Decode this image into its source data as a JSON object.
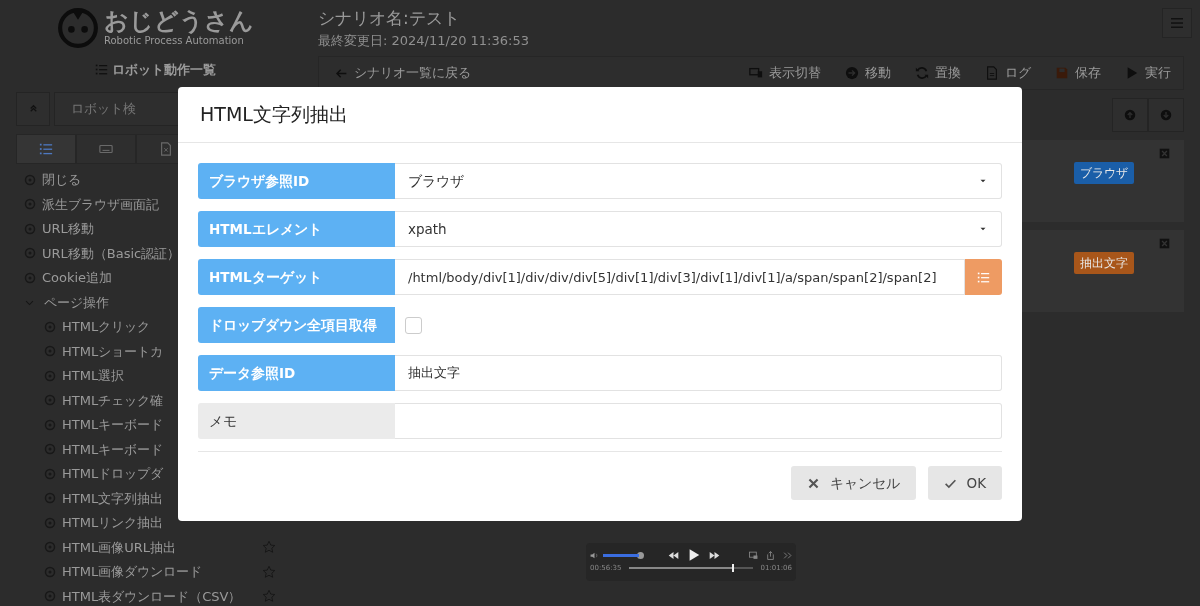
{
  "header": {
    "logo_title": "おじどうさん",
    "logo_subtitle": "Robotic Process Automation",
    "scenario_name": "シナリオ名:テスト",
    "last_modified": "最終変更日: 2024/11/20 11:36:53"
  },
  "sidebar": {
    "heading": "ロボット動作一覧",
    "search": {
      "placeholder": "ロボット検"
    },
    "tabs": [
      {
        "kind": "list",
        "selected": true
      },
      {
        "kind": "keyboard",
        "selected": false
      },
      {
        "kind": "file",
        "selected": false
      }
    ],
    "items": [
      {
        "label": "閉じる"
      },
      {
        "label": "派生ブラウザ画面記"
      },
      {
        "label": "URL移動"
      },
      {
        "label": "URL移動（Basic認証）"
      },
      {
        "label": "Cookie追加"
      },
      {
        "label": "ページ操作",
        "expanded": true,
        "children": [
          {
            "label": "HTMLクリック"
          },
          {
            "label": "HTMLショートカ"
          },
          {
            "label": "HTML選択"
          },
          {
            "label": "HTMLチェック確"
          },
          {
            "label": "HTMLキーボード"
          },
          {
            "label": "HTMLキーボード"
          },
          {
            "label": "HTMLドロップダ"
          },
          {
            "label": "HTML文字列抽出"
          },
          {
            "label": "HTMLリンク抽出"
          },
          {
            "label": "HTML画像URL抽出",
            "starred": false
          },
          {
            "label": "HTML画像ダウンロード",
            "starred": false
          },
          {
            "label": "HTML表ダウンロード（CSV）",
            "starred": false
          }
        ]
      }
    ]
  },
  "toolbar": {
    "back": "シナリオ一覧に戻る",
    "buttons": [
      {
        "kind": "display",
        "label": "表示切替"
      },
      {
        "kind": "move",
        "label": "移動"
      },
      {
        "kind": "replace",
        "label": "置換"
      },
      {
        "kind": "log",
        "label": "ログ"
      },
      {
        "kind": "save",
        "label": "保存"
      },
      {
        "kind": "run",
        "label": "実行"
      }
    ]
  },
  "steps": [
    {
      "tag": "ブラウザ",
      "color": "#1a5ea8"
    },
    {
      "tag": "抽出文字",
      "color": "#a8561a"
    }
  ],
  "dialog": {
    "title": "HTML文字列抽出",
    "fields": [
      {
        "kind": "select",
        "label": "ブラウザ参照ID",
        "required": true,
        "value": "ブラウザ"
      },
      {
        "kind": "select",
        "label": "HTMLエレメント",
        "required": true,
        "value": "xpath"
      },
      {
        "kind": "picker",
        "label": "HTMLターゲット",
        "required": true,
        "value": "/html/body/div[1]/div/div/div[5]/div[1]/div[3]/div[1]/div[1]/a/span/span[2]/span[2]"
      },
      {
        "kind": "checkbox",
        "label": "ドロップダウン全項目取得",
        "required": true,
        "checked": false
      },
      {
        "kind": "text",
        "label": "データ参照ID",
        "required": true,
        "value": "抽出文字"
      },
      {
        "kind": "text",
        "label": "メモ",
        "required": false
      }
    ],
    "buttons": [
      {
        "kind": "cancel",
        "label": "キャンセル"
      },
      {
        "kind": "ok",
        "label": "OK"
      }
    ]
  },
  "player": {
    "volume": {
      "level": 1.0
    },
    "elapsed": "00:56:35",
    "remaining": "01:01:06",
    "progress": {
      "level": 0.83
    }
  }
}
